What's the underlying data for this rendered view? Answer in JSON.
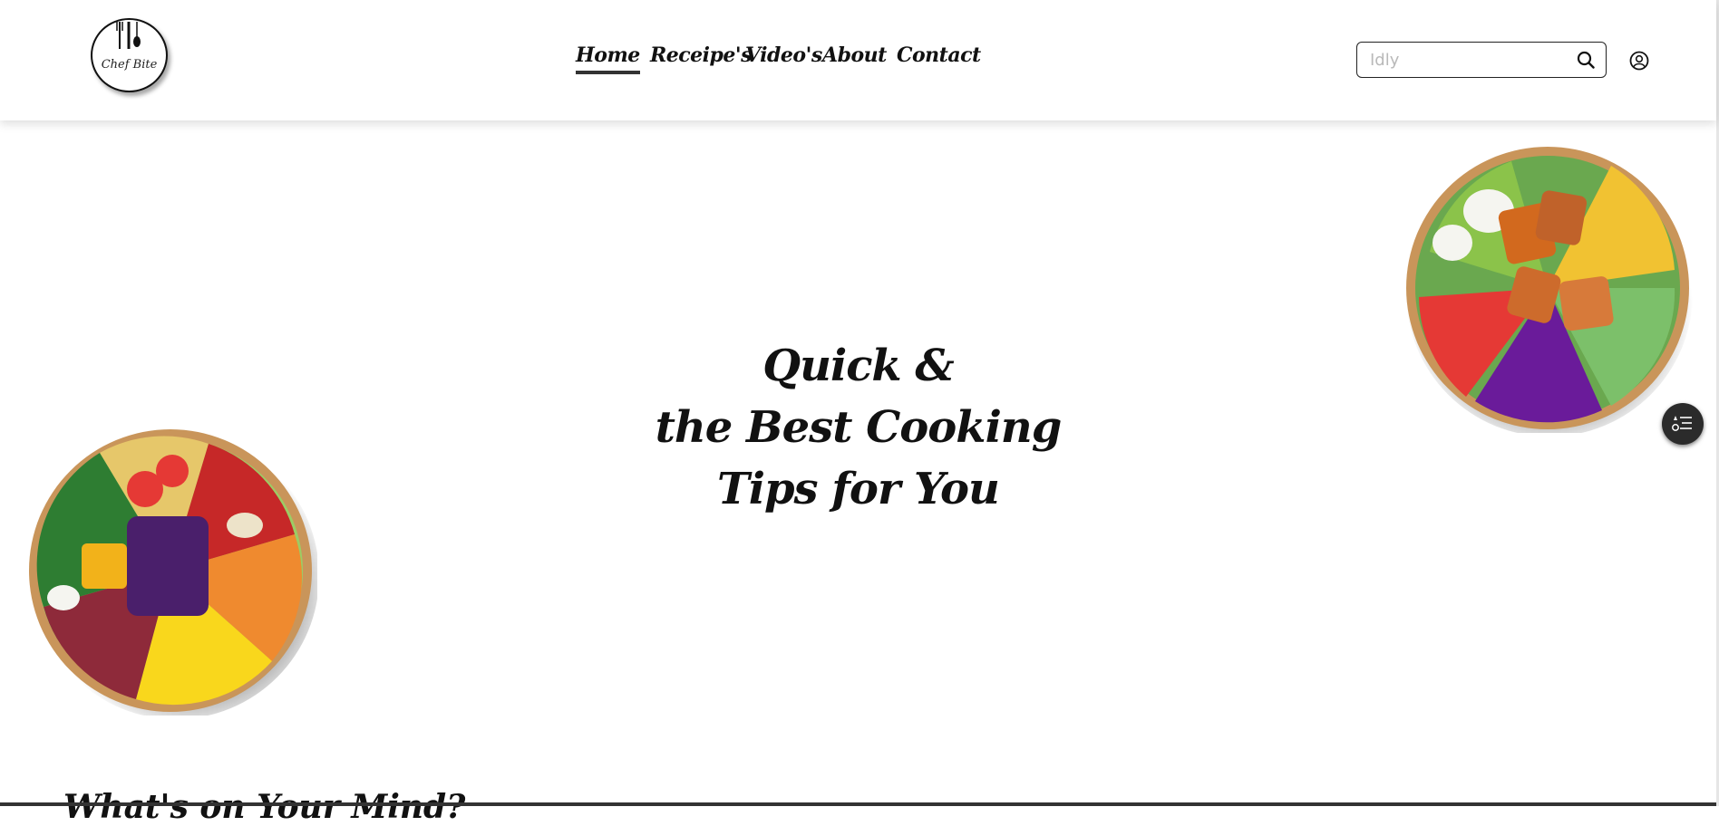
{
  "header": {
    "logo_text": "Chef Bite",
    "nav": [
      {
        "label": "Home",
        "active": true
      },
      {
        "label": "Receipe's",
        "active": false
      },
      {
        "label": "Video's",
        "active": false
      },
      {
        "label": "About",
        "active": false
      },
      {
        "label": "Contact",
        "active": false
      }
    ],
    "search": {
      "placeholder": "Idly",
      "value": ""
    },
    "icons": {
      "search": "search-icon",
      "user": "user-circle-icon"
    }
  },
  "hero": {
    "lines": [
      "Quick &",
      "the Best Cooking",
      "Tips for You"
    ]
  },
  "floating_button": {
    "icon": "menu-list-icon"
  },
  "section": {
    "title": "What's on Your Mind?"
  },
  "colors": {
    "accent": "#333333",
    "text": "#111111",
    "bowl": "#c9955a"
  }
}
